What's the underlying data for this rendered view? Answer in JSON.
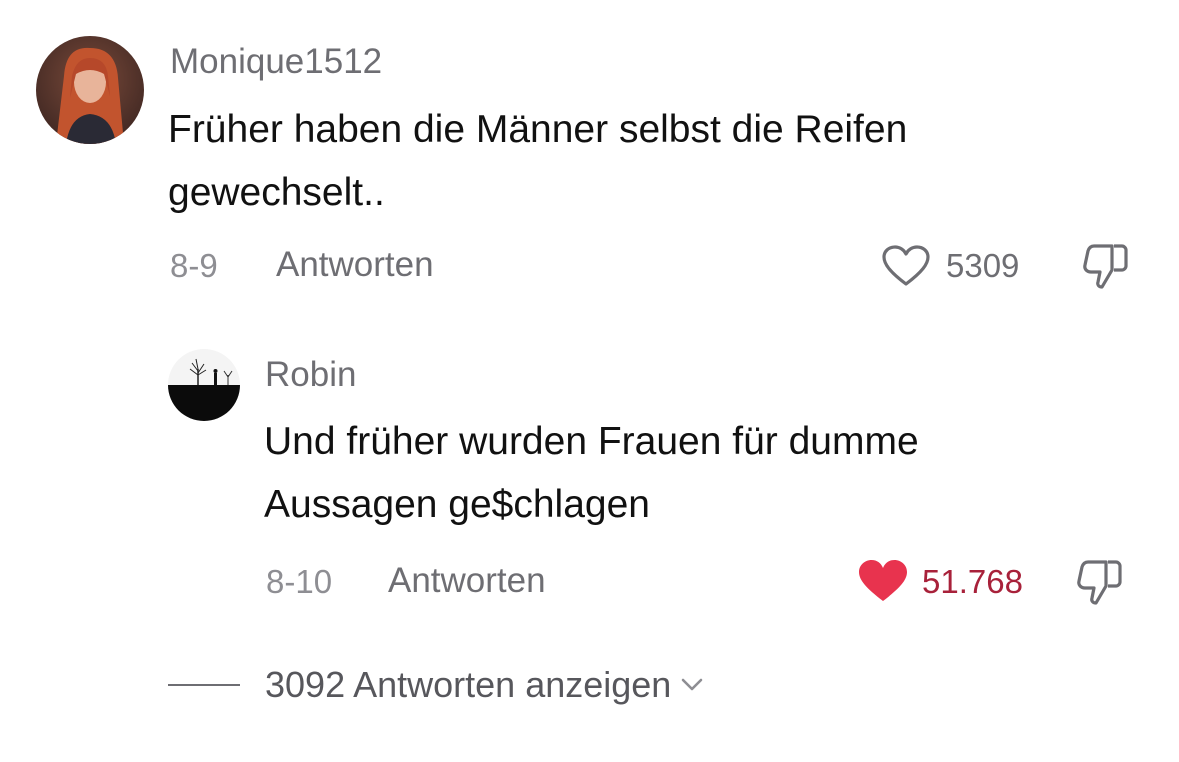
{
  "comments": [
    {
      "username": "Monique1512",
      "text_line1": "Früher haben die Männer selbst die Reifen",
      "text_line2": "gewechselt..",
      "date": "8-9",
      "reply_label": "Antworten",
      "likes": "5309",
      "liked": false
    },
    {
      "username": "Robin",
      "text_line1": "Und früher wurden Frauen für dumme",
      "text_line2": "Aussagen ge$chlagen",
      "date": "8-10",
      "reply_label": "Antworten",
      "likes": "51.768",
      "liked": true
    }
  ],
  "view_replies_label": "3092 Antworten anzeigen",
  "colors": {
    "liked_heart": "#e8334e",
    "liked_count": "#a8213a",
    "muted": "#6e6e73"
  },
  "icons": [
    "heart-outline-icon",
    "heart-filled-icon",
    "thumbs-down-icon",
    "chevron-down-icon"
  ]
}
